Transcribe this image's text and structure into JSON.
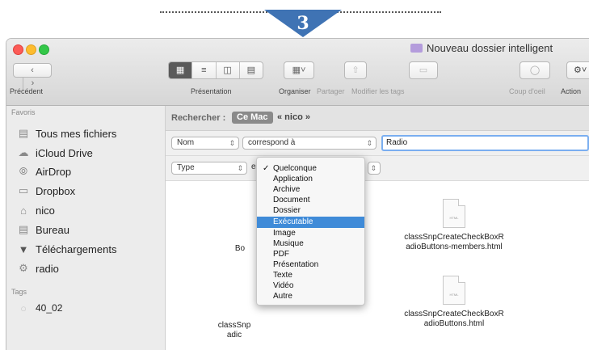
{
  "callout": {
    "step": "3"
  },
  "window": {
    "title": "Nouveau dossier intelligent",
    "nav": {
      "back_icon": "chevron-left",
      "forward_icon": "chevron-right",
      "label": "Précédent"
    }
  },
  "toolbar": {
    "view_label": "Présentation",
    "view_modes": [
      "icons",
      "list",
      "columns",
      "coverflow"
    ],
    "organiser_label": "Organiser",
    "share_label": "Partager",
    "tags_label": "Modifier les tags",
    "quicklook_label": "Coup d'oeil",
    "action_label": "Action"
  },
  "sidebar": {
    "favorites_header": "Favoris",
    "items": [
      {
        "label": "Tous mes fichiers",
        "icon": "all-files"
      },
      {
        "label": "iCloud Drive",
        "icon": "cloud"
      },
      {
        "label": "AirDrop",
        "icon": "airdrop"
      },
      {
        "label": "Dropbox",
        "icon": "folder"
      },
      {
        "label": "nico",
        "icon": "home"
      },
      {
        "label": "Bureau",
        "icon": "desktop"
      },
      {
        "label": "Téléchargements",
        "icon": "download"
      },
      {
        "label": "radio",
        "icon": "gear"
      }
    ],
    "tags_header": "Tags",
    "tags": [
      {
        "label": "40_02",
        "color": "#c8c8c8"
      }
    ]
  },
  "search": {
    "label": "Rechercher :",
    "scope_active": "Ce Mac",
    "scope_other": "« nico »",
    "row1": {
      "attribute": "Nom",
      "operator": "correspond à",
      "value": "Radio"
    },
    "row2": {
      "attribute": "Type",
      "operator_partial": "es"
    }
  },
  "files": [
    {
      "name_line1": "Bo",
      "name_line2": ""
    },
    {
      "name_line1": "classSnpCreateCheckBoxR",
      "name_line2": "adioButtons-members.html",
      "doc_tag": "HTML"
    },
    {
      "name_line1": "classSnp",
      "name_line2": "adic"
    },
    {
      "name_line1": "classSnpCreateCheckBoxR",
      "name_line2": "adioButtons.html",
      "doc_tag": "HTML"
    }
  ],
  "type_menu": {
    "checked": "Quelconque",
    "highlighted": "Exécutable",
    "items": [
      "Quelconque",
      "Application",
      "Archive",
      "Document",
      "Dossier",
      "Exécutable",
      "Image",
      "Musique",
      "PDF",
      "Présentation",
      "Texte",
      "Vidéo",
      "Autre"
    ]
  },
  "colors": {
    "highlight": "#3f8bd8",
    "callout": "#3f73b4",
    "focus_ring": "#7aaef0"
  }
}
